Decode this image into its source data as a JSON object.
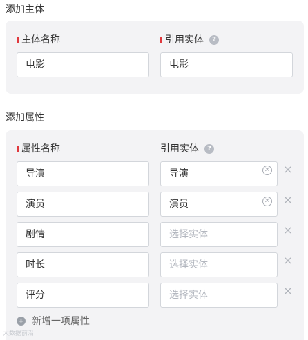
{
  "subject_section": {
    "title": "添加主体",
    "name_label": "主体名称",
    "entity_label": "引用实体",
    "name_value": "电影",
    "entity_value": "电影"
  },
  "attr_section": {
    "title": "添加属性",
    "name_label": "属性名称",
    "entity_label": "引用实体",
    "placeholder": "选择实体",
    "rows": [
      {
        "name": "导演",
        "entity": "导演"
      },
      {
        "name": "演员",
        "entity": "演员"
      },
      {
        "name": "剧情",
        "entity": ""
      },
      {
        "name": "时长",
        "entity": ""
      },
      {
        "name": "评分",
        "entity": ""
      }
    ],
    "add_label": "新增一项属性"
  },
  "help_glyph": "?",
  "watermark": "大数据前沿"
}
